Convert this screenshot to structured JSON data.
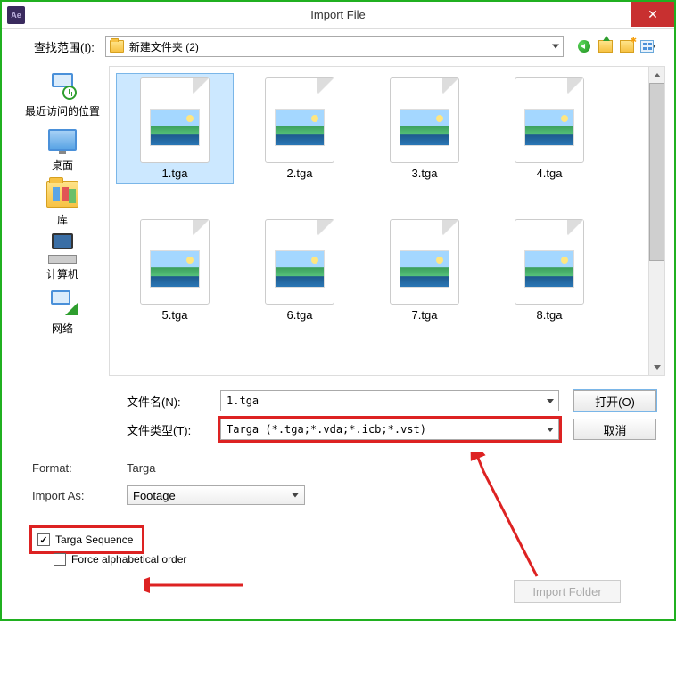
{
  "title": "Import File",
  "close": "✕",
  "lookIn": {
    "label": "查找范围(I):",
    "value": "新建文件夹 (2)"
  },
  "sidebar": {
    "items": [
      {
        "label": "最近访问的位置"
      },
      {
        "label": "桌面"
      },
      {
        "label": "库"
      },
      {
        "label": "计算机"
      },
      {
        "label": "网络"
      }
    ]
  },
  "files": [
    {
      "name": "1.tga",
      "selected": true
    },
    {
      "name": "2.tga",
      "selected": false
    },
    {
      "name": "3.tga",
      "selected": false
    },
    {
      "name": "4.tga",
      "selected": false
    },
    {
      "name": "5.tga",
      "selected": false
    },
    {
      "name": "6.tga",
      "selected": false
    },
    {
      "name": "7.tga",
      "selected": false
    },
    {
      "name": "8.tga",
      "selected": false
    }
  ],
  "fileNameRow": {
    "label": "文件名(N):",
    "value": "1.tga",
    "button": "打开(O)"
  },
  "fileTypeRow": {
    "label": "文件类型(T):",
    "value": "Targa (*.tga;*.vda;*.icb;*.vst)",
    "button": "取消"
  },
  "formatRow": {
    "label": "Format:",
    "value": "Targa"
  },
  "importAsRow": {
    "label": "Import As:",
    "value": "Footage"
  },
  "sequence": {
    "label": "Targa Sequence",
    "checked": true
  },
  "forceAlpha": {
    "label": "Force alphabetical order",
    "checked": false
  },
  "importFolder": "Import Folder"
}
